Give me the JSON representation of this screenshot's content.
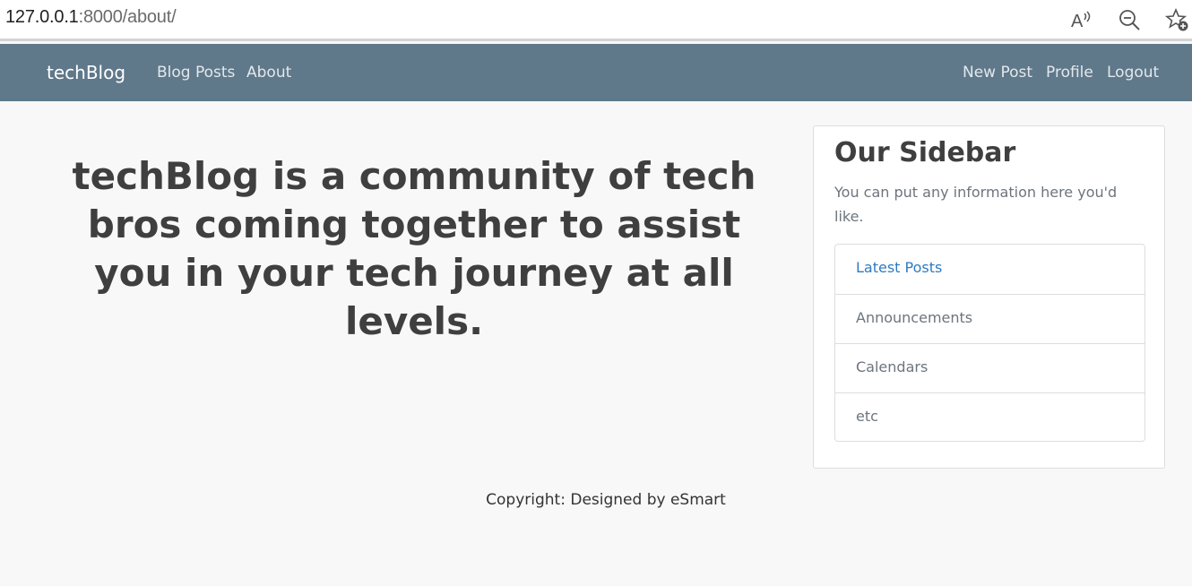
{
  "browser": {
    "url_host": "127.0.0.1",
    "url_path": ":8000/about/",
    "icons": [
      "read-aloud-icon",
      "zoom-out-icon",
      "favorite-add-icon"
    ]
  },
  "navbar": {
    "brand": "techBlog",
    "left_links": [
      "Blog Posts",
      "About"
    ],
    "right_links": [
      "New Post",
      "Profile",
      "Logout"
    ],
    "background": "#5f788a"
  },
  "main": {
    "headline": "techBlog is a community of tech bros coming together to assist you in your tech journey at all levels."
  },
  "sidebar": {
    "title": "Our Sidebar",
    "text": "You can put any information here you'd like.",
    "items": [
      {
        "label": "Latest Posts"
      },
      {
        "label": "Announcements"
      },
      {
        "label": "Calendars"
      },
      {
        "label": "etc"
      }
    ]
  },
  "footer": {
    "text": "Copyright: Designed by eSmart"
  }
}
